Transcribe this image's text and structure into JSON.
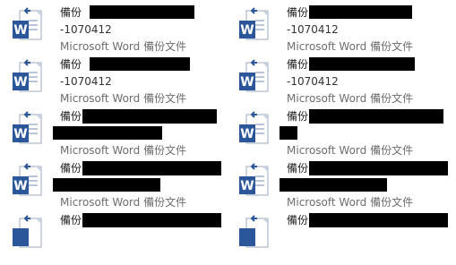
{
  "files": [
    {
      "name": "備份",
      "line2": "-1070412",
      "type": "Microsoft Word 備份文件"
    },
    {
      "name": "備份",
      "line2": "-1070412",
      "type": "Microsoft Word 備份文件"
    },
    {
      "name": "備份",
      "line2": "-1070412",
      "type": "Microsoft Word 備份文件"
    },
    {
      "name": "備份",
      "line2": "-1070412",
      "type": "Microsoft Word 備份文件"
    },
    {
      "name": "備份",
      "line2": "",
      "type": "Microsoft Word 備份文件"
    },
    {
      "name": "備份",
      "line2": "",
      "type": "Microsoft Word 備份文件"
    },
    {
      "name": "備份",
      "line2": "",
      "type": "Microsoft Word 備份文件"
    },
    {
      "name": "備份",
      "line2": "",
      "type": "Microsoft Word 備份文件"
    },
    {
      "name": "備份",
      "line2": "",
      "type": ""
    },
    {
      "name": "備份",
      "line2": "",
      "type": ""
    }
  ],
  "icon": "word-document-icon",
  "colors": {
    "word_blue": "#2b579a",
    "redaction": "#000000"
  }
}
